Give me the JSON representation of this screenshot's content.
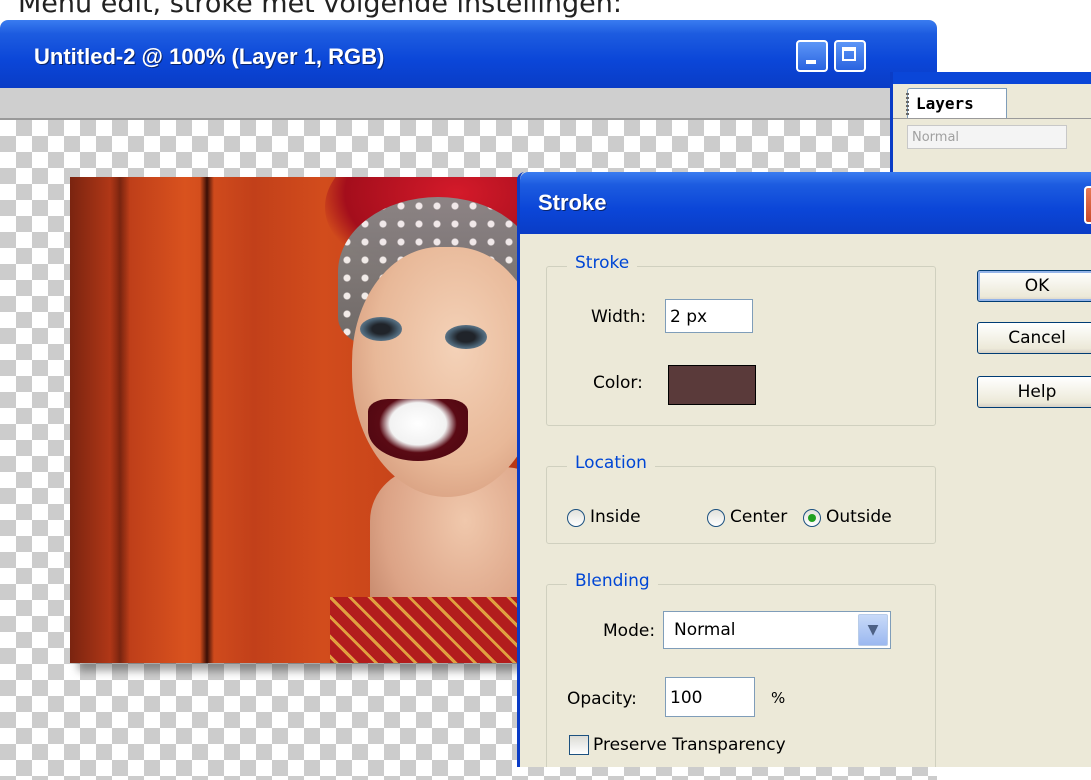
{
  "caption": "Menu edit, stroke met volgende instellingen:",
  "document_window": {
    "title": "Untitled-2 @ 100% (Layer 1, RGB)"
  },
  "layers_panel": {
    "tab_label": "Layers",
    "blend_mode": "Normal"
  },
  "stroke_dialog": {
    "title": "Stroke",
    "stroke_group": {
      "legend": "Stroke",
      "width_label": "Width:",
      "width_value": "2 px",
      "color_label": "Color:",
      "color_value": "#5a3a3a"
    },
    "location_group": {
      "legend": "Location",
      "options": [
        "Inside",
        "Center",
        "Outside"
      ],
      "selected": "Outside"
    },
    "blending_group": {
      "legend": "Blending",
      "mode_label": "Mode:",
      "mode_value": "Normal",
      "opacity_label": "Opacity:",
      "opacity_value": "100",
      "opacity_unit": "%",
      "preserve_transparency_label": "Preserve Transparency",
      "preserve_transparency_checked": false
    },
    "buttons": {
      "ok": "OK",
      "cancel": "Cancel",
      "help": "Help"
    }
  },
  "colors": {
    "titlebar_blue": "#0a46d8",
    "group_legend": "#0046d5",
    "dialog_bg": "#ece9d8",
    "radio_selected": "#21a121"
  }
}
